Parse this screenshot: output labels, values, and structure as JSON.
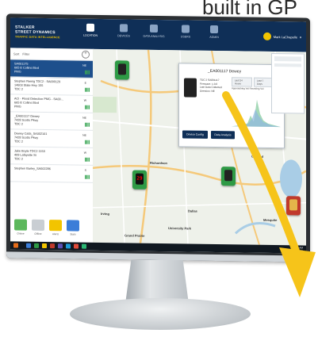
{
  "caption": "built in GP",
  "app": {
    "logo_line1": "STALKER",
    "logo_line2": "STREET DYNAMICS",
    "logo_tagline": "TRAFFIC DATA INTELLIGENCE"
  },
  "nav": [
    {
      "label": "LOCATION",
      "active": true,
      "icon": "location-pin-icon"
    },
    {
      "label": "DEVICES",
      "active": false,
      "icon": "devices-icon"
    },
    {
      "label": "DATA ANALYSIS",
      "active": false,
      "icon": "chart-icon"
    },
    {
      "label": "USERS",
      "active": false,
      "icon": "users-icon"
    },
    {
      "label": "ADMIN",
      "active": false,
      "icon": "gear-icon"
    }
  ],
  "user": {
    "name": "Mark LaChapelle"
  },
  "sidebar": {
    "search_label": "Sort",
    "filter_label": "Filter",
    "devices": [
      {
        "name": "SA001175",
        "address": "665 E Collins Blvd",
        "type": "PMG",
        "tag": "NE",
        "selected": true
      },
      {
        "name": "Stephen Remig TDC2 - SA000129",
        "address": "14603 State Hwy 155",
        "type": "TDC 2",
        "tag": "E",
        "selected": false
      },
      {
        "name": "ACI - Flood Detection PMG - SA00...",
        "address": "665 E Collins Blvd",
        "type": "PMG",
        "tag": "W",
        "selected": false
      },
      {
        "name": "_EA001117 Dewey",
        "address": "7428 Scotts Pkwy",
        "type": "TDC 2",
        "tag": "NE",
        "selected": false
      },
      {
        "name": "Dewey Catts_SA002101",
        "address": "7428 Scotts Pkwy",
        "type": "TDC 2",
        "tag": "NE",
        "selected": false
      },
      {
        "name": "Jake Boyle TDC2 1153",
        "address": "409 Lafayette St",
        "type": "TDC 2",
        "tag": "W",
        "selected": false
      },
      {
        "name": "Stephen Barley_SA002286",
        "address": "",
        "type": "",
        "tag": "S",
        "selected": false
      }
    ],
    "tiles": [
      {
        "label": "Online",
        "color": "#5cb85c"
      },
      {
        "label": "Offline",
        "color": "#c9ced3"
      },
      {
        "label": "Alerts",
        "color": "#f2c400"
      },
      {
        "label": "Stats",
        "color": "#3b7dd8"
      }
    ]
  },
  "map": {
    "labels": [
      "Richardson",
      "Garland",
      "Dallas",
      "Mesquite",
      "Irving",
      "Grand Prairie",
      "University Park"
    ]
  },
  "popup": {
    "title": "_EA001117 Dewey",
    "info_lines": [
      "TDC 2 SA001117",
      "Firmware: 1.0.0",
      "Last Data Collected",
      "Direction: NE"
    ],
    "tabs": [
      "Last 24 Hours",
      "Last 7 Days",
      "Cfg"
    ],
    "legend": "Approaching Vol   Receding Vol",
    "btn_config": "Device Config",
    "btn_analysis": "Data Analysis",
    "close": "×"
  },
  "marker_display_value": "29",
  "taskbar": {
    "time": "9:57 AM",
    "date": "4/21/2021"
  },
  "colors": {
    "header": "#0f2f57",
    "accent": "#f2c400",
    "online": "#2e9a45"
  }
}
